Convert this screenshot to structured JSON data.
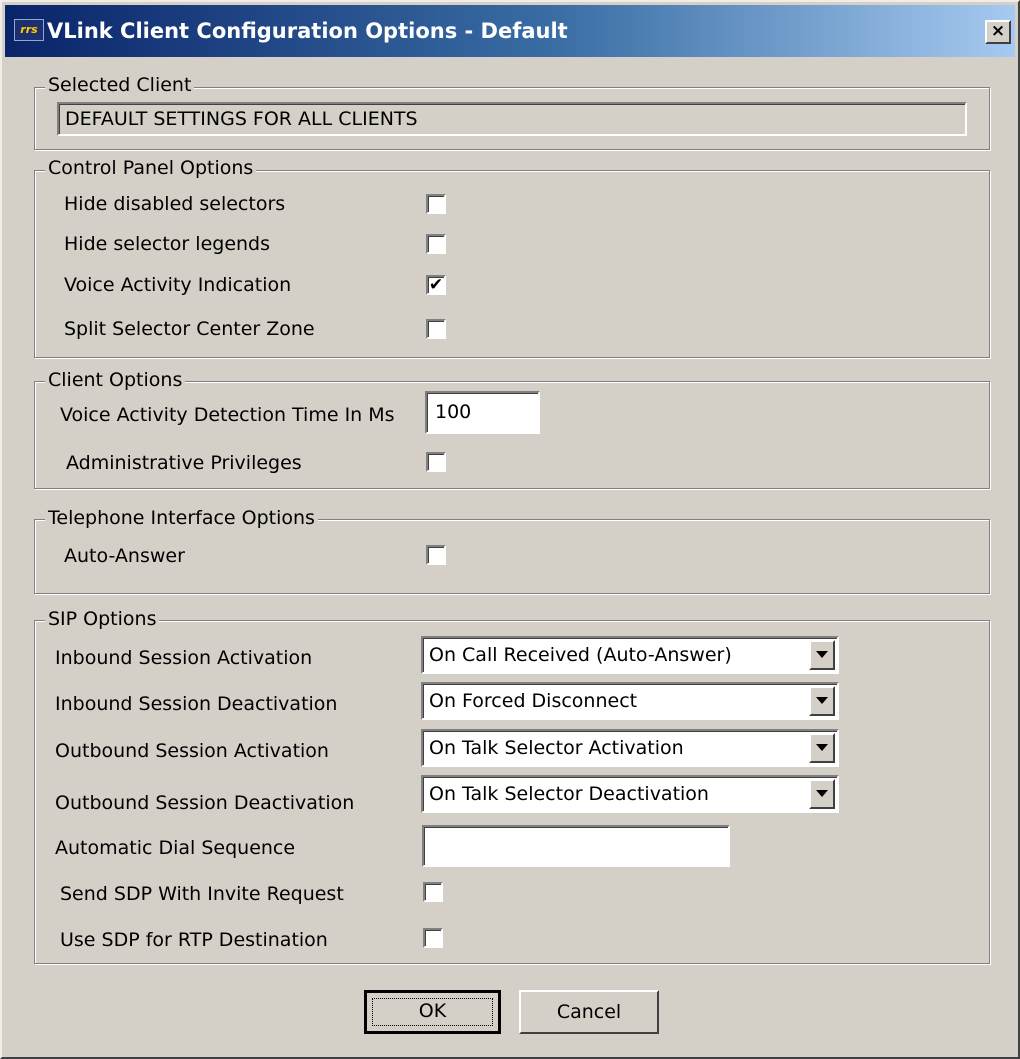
{
  "window": {
    "title": "VLink Client Configuration Options - Default",
    "app_icon_text": "rrs",
    "close_glyph": "×"
  },
  "selected_client": {
    "legend": "Selected Client",
    "value": "DEFAULT SETTINGS FOR ALL CLIENTS"
  },
  "control_panel": {
    "legend": "Control Panel Options",
    "options": [
      {
        "label": "Hide disabled selectors",
        "checked": false
      },
      {
        "label": "Hide selector legends",
        "checked": false
      },
      {
        "label": "Voice Activity Indication",
        "checked": true
      },
      {
        "label": "Split Selector Center Zone",
        "checked": false
      }
    ]
  },
  "client_options": {
    "legend": "Client Options",
    "vad_label": "Voice Activity Detection Time In Ms",
    "vad_value": "100",
    "admin_label": "Administrative Privileges",
    "admin_checked": false
  },
  "telephone": {
    "legend": "Telephone Interface Options",
    "auto_answer_label": "Auto-Answer",
    "auto_answer_checked": false
  },
  "sip": {
    "legend": "SIP Options",
    "selects": [
      {
        "label": "Inbound Session Activation",
        "value": "On Call Received (Auto-Answer)"
      },
      {
        "label": "Inbound Session Deactivation",
        "value": "On Forced Disconnect"
      },
      {
        "label": "Outbound Session Activation",
        "value": "On Talk Selector Activation"
      },
      {
        "label": "Outbound Session Deactivation",
        "value": "On Talk Selector Deactivation"
      }
    ],
    "dial_label": "Automatic Dial Sequence",
    "dial_value": "",
    "sdp_invite_label": "Send SDP With Invite Request",
    "sdp_invite_checked": false,
    "sdp_rtp_label": "Use SDP for RTP Destination",
    "sdp_rtp_checked": false
  },
  "buttons": {
    "ok": "OK",
    "cancel": "Cancel"
  },
  "check_glyph": "✔",
  "colors": {
    "titlebar_start": "#0a246a",
    "titlebar_end": "#a6caf0",
    "dialog_bg": "#d4d0c8"
  }
}
